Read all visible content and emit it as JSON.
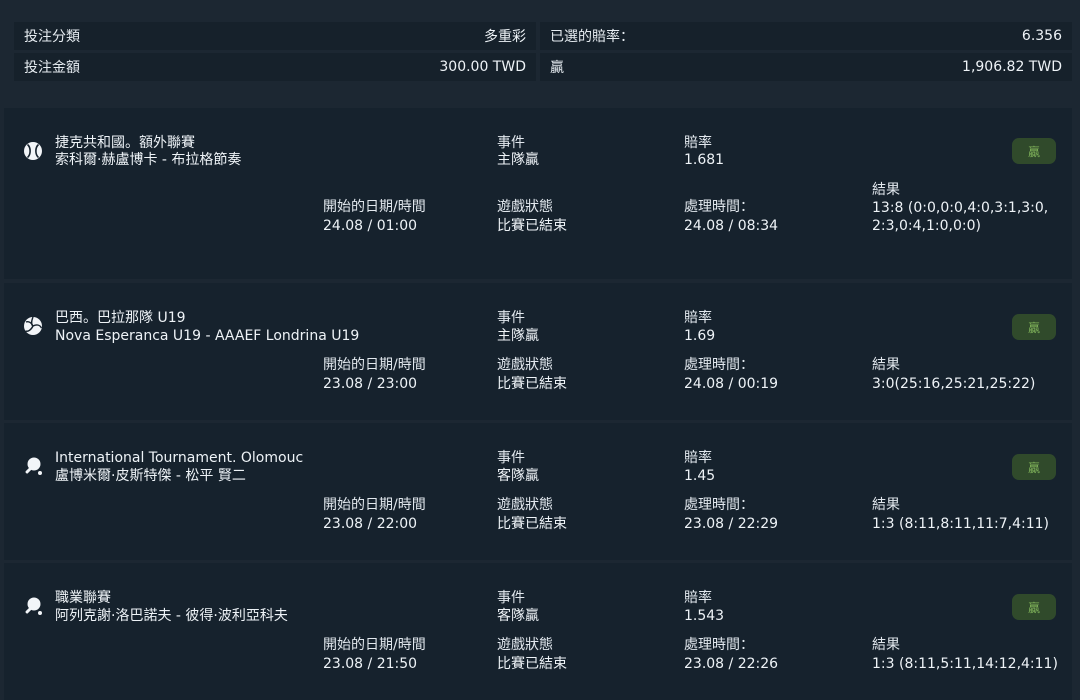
{
  "summary": {
    "bet_type_label": "投注分類",
    "bet_type_value": "多重彩",
    "selected_odds_label": "已選的賠率：",
    "selected_odds_value": "6.356",
    "stake_label": "投注金額",
    "stake_value": "300.00 TWD",
    "win_label": "贏",
    "win_value": "1,906.82 TWD"
  },
  "labels": {
    "event": "事件",
    "odds": "賠率",
    "start_time": "開始的日期/時間",
    "game_status": "遊戲狀態",
    "settle_time": "處理時間：",
    "result": "結果"
  },
  "bets": [
    {
      "sport_icon": "baseball-icon",
      "league": "捷克共和國。額外聯賽",
      "match": "索科爾·赫盧博卡 - 布拉格節奏",
      "event": "主隊贏",
      "odds": "1.681",
      "badge": "贏",
      "start_time": "24.08 / 01:00",
      "status": "比賽已結束",
      "settle_time": "24.08 / 08:34",
      "result": "13:8 (0:0,0:0,4:0,3:1,3:0,2:3,0:4,1:0,0:0)"
    },
    {
      "sport_icon": "volleyball-icon",
      "league": "巴西。巴拉那隊 U19",
      "match": "Nova Esperanca U19 - AAAEF Londrina U19",
      "event": "主隊贏",
      "odds": "1.69",
      "badge": "贏",
      "start_time": "23.08 / 23:00",
      "status": "比賽已結束",
      "settle_time": "24.08 / 00:19",
      "result": "3:0(25:16,25:21,25:22)"
    },
    {
      "sport_icon": "table-tennis-icon",
      "league": "International Tournament. Olomouc",
      "match": "盧博米爾·皮斯特傑 - 松平 賢二",
      "event": "客隊贏",
      "odds": "1.45",
      "badge": "贏",
      "start_time": "23.08 / 22:00",
      "status": "比賽已結束",
      "settle_time": "23.08 / 22:29",
      "result": "1:3 (8:11,8:11,11:7,4:11)"
    },
    {
      "sport_icon": "table-tennis-icon",
      "league": "職業聯賽",
      "match": "阿列克謝·洛巴諾夫 - 彼得·波利亞科夫",
      "event": "客隊贏",
      "odds": "1.543",
      "badge": "贏",
      "start_time": "23.08 / 21:50",
      "status": "比賽已結束",
      "settle_time": "23.08 / 22:26",
      "result": "1:3 (8:11,5:11,14:12,4:11)"
    }
  ],
  "colors": {
    "background": "#1c2732",
    "card": "#16222d",
    "badge_bg": "#304a2b",
    "badge_text": "#7fb25a"
  }
}
